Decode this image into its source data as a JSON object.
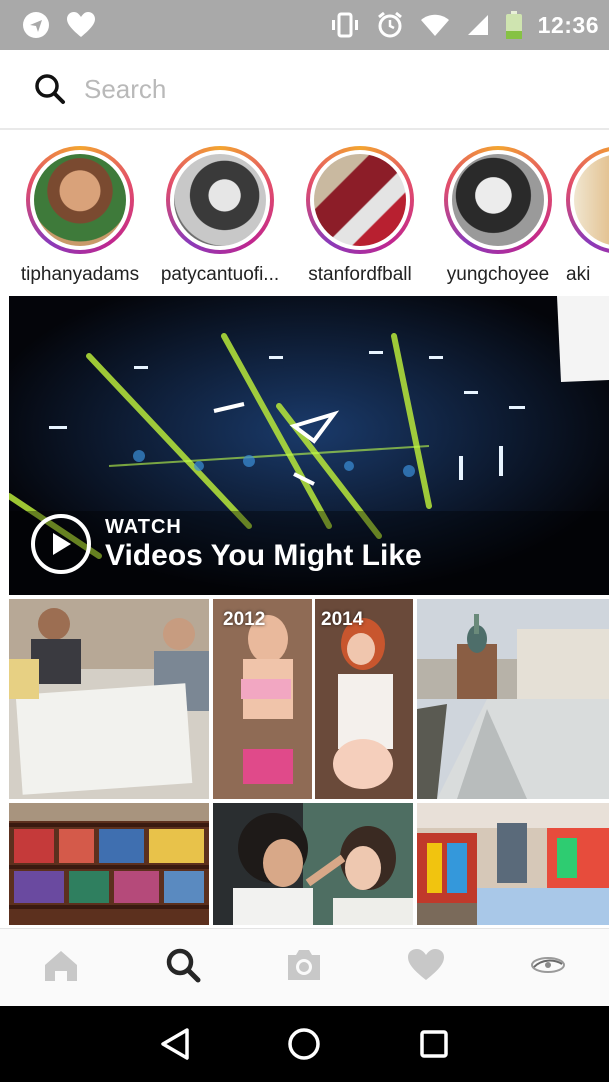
{
  "status_bar": {
    "time": "12:36",
    "left_icons": [
      "send-notification-icon",
      "heart-notification-icon"
    ],
    "right_icons": [
      "vibrate-icon",
      "alarm-icon",
      "wifi-icon",
      "signal-icon",
      "battery-icon"
    ]
  },
  "search": {
    "placeholder": "Search",
    "value": ""
  },
  "stories": [
    {
      "username": "tiphanyadams",
      "avatar_color": "#b08060"
    },
    {
      "username": "patycantuofi...",
      "avatar_color": "#8a8a8a"
    },
    {
      "username": "stanfordfball",
      "avatar_color": "#8c1d28"
    },
    {
      "username": "yungchoyee",
      "avatar_color": "#6a6a6a"
    },
    {
      "username": "aki",
      "avatar_color": "#d08a30"
    }
  ],
  "video_hero": {
    "label": "WATCH",
    "title": "Videos You Might Like"
  },
  "grid": {
    "tiles": [
      {
        "kind": "photo",
        "colors": [
          "#d8d4cc",
          "#a07a64"
        ]
      },
      {
        "kind": "photo",
        "colors": [
          "#8a6040",
          "#e5b8a0"
        ],
        "years": [
          "2012",
          "2014"
        ]
      },
      {
        "kind": "photo",
        "colors": [
          "#cfd5dc",
          "#8a8a7e"
        ]
      },
      {
        "kind": "photo",
        "colors": [
          "#6a3a24",
          "#c43a3a"
        ]
      },
      {
        "kind": "photo",
        "colors": [
          "#5a7a6a",
          "#d9b8a0"
        ]
      },
      {
        "kind": "photo",
        "colors": [
          "#c9b09a",
          "#5a78a8"
        ]
      }
    ]
  },
  "bottom_nav": {
    "items": [
      "home-icon",
      "search-icon",
      "camera-icon",
      "heart-icon",
      "profile-icon"
    ],
    "active": "search-icon"
  },
  "android_nav": {
    "items": [
      "back-icon",
      "home-circle-icon",
      "recents-icon"
    ]
  },
  "colors": {
    "status_bar_bg": "#a9a9a9",
    "story_ring_start": "#f3a530",
    "story_ring_end": "#c0268e",
    "nav_inactive": "#c8c8c8",
    "nav_active": "#262626"
  }
}
